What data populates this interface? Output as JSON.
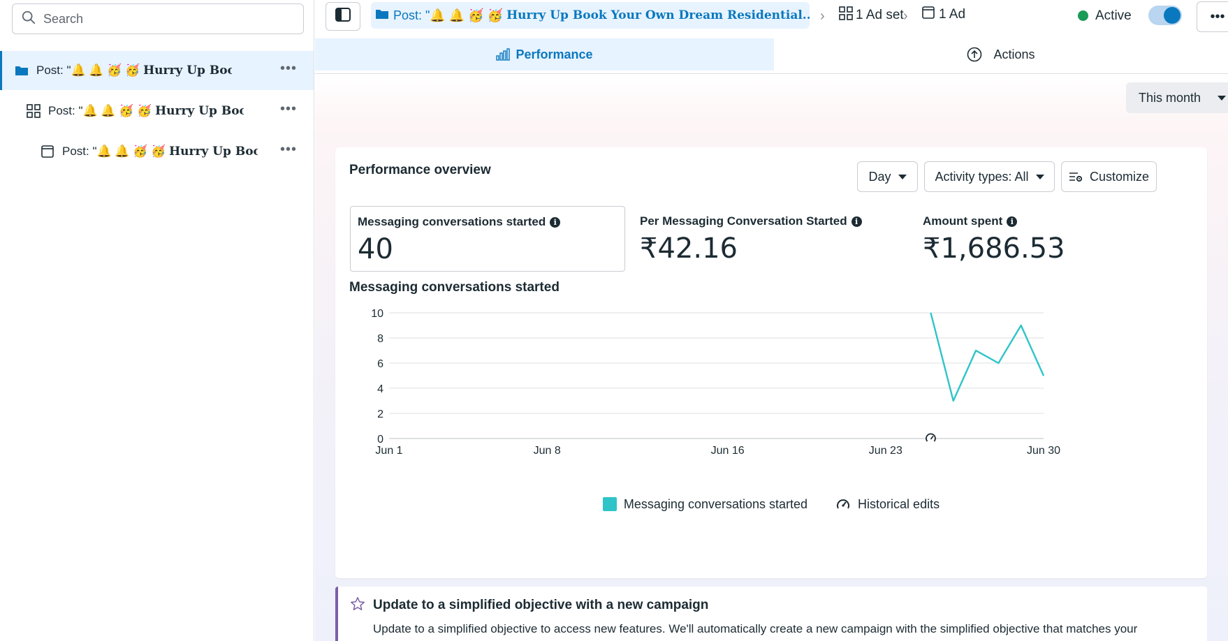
{
  "sidebar": {
    "search": {
      "placeholder": "Search"
    },
    "tree": [
      {
        "prefix": "Post: \"",
        "emoji": "🔔 🔔 🥳 🥳",
        "title": "Hurry Up Book Your ...",
        "icon": "folder-icon"
      },
      {
        "prefix": "Post: \"",
        "emoji": "🔔 🔔 🥳 🥳",
        "title": "Hurry Up Book Yo...",
        "icon": "grid-icon"
      },
      {
        "prefix": "Post: \"",
        "emoji": "🔔 🔔 🥳 🥳",
        "title": "Hurry Up Book ...",
        "icon": "window-icon"
      }
    ]
  },
  "topbar": {
    "crumb_prefix": "Post: \"",
    "crumb_emoji": "🔔 🔔 🥳 🥳",
    "crumb_title": "Hurry Up Book Your Own Dream Residential...\"",
    "adset_label": "1 Ad set",
    "ad_label": "1 Ad",
    "status": "Active",
    "status_color": "#1a9b56",
    "toggle_on": true
  },
  "tabs": {
    "performance": "Performance",
    "actions": "Actions"
  },
  "date_range": "This month",
  "overview": {
    "title": "Performance overview",
    "granularity": "Day",
    "activity": "Activity types: All",
    "customize": "Customize",
    "metrics": [
      {
        "label": "Messaging conversations started",
        "value": "40"
      },
      {
        "label": "Per Messaging Conversation Started",
        "value": "₹42.16"
      },
      {
        "label": "Amount spent",
        "value": "₹1,686.53"
      }
    ],
    "chart_heading": "Messaging conversations started",
    "legend": {
      "series": "Messaging conversations started",
      "edits": "Historical edits"
    }
  },
  "chart_data": {
    "type": "line",
    "title": "Messaging conversations started",
    "xlabel": "",
    "ylabel": "",
    "ylim": [
      0,
      10
    ],
    "yticks": [
      0,
      2,
      4,
      6,
      8,
      10
    ],
    "x_tick_labels": [
      "Jun 1",
      "Jun 8",
      "Jun 16",
      "Jun 23",
      "Jun 30"
    ],
    "grid": true,
    "legend_position": "bottom",
    "series": [
      {
        "name": "Messaging conversations started",
        "color": "#2ec4c8",
        "x": [
          "Jun 25",
          "Jun 26",
          "Jun 27",
          "Jun 28",
          "Jun 29",
          "Jun 30"
        ],
        "values": [
          10,
          3,
          7,
          6,
          9,
          5
        ]
      }
    ],
    "historical_edit_markers": [
      "Jun 25"
    ]
  },
  "notice": {
    "title": "Update to a simplified objective with a new campaign",
    "body": "Update to a simplified objective to access new features. We'll automatically create a new campaign with the simplified objective that matches your"
  }
}
